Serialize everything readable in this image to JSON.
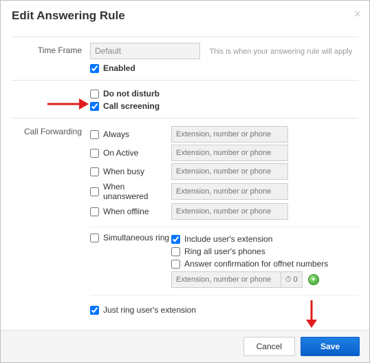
{
  "title": "Edit Answering Rule",
  "timeFrame": {
    "label": "Time Frame",
    "value": "Default",
    "help": "This is when your answering rule will apply",
    "enabledLabel": "Enabled"
  },
  "options": {
    "dndLabel": "Do not disturb",
    "screeningLabel": "Call screening"
  },
  "forwarding": {
    "label": "Call Forwarding",
    "placeholder": "Extension, number or phone",
    "items": [
      {
        "label": "Always"
      },
      {
        "label": "On Active"
      },
      {
        "label": "When busy"
      },
      {
        "label": "When unanswered"
      },
      {
        "label": "When offline"
      }
    ]
  },
  "simring": {
    "label": "Simultaneous ring",
    "includeExtLabel": "Include user's extension",
    "ringAllLabel": "Ring all user's phones",
    "answerConfirmLabel": "Answer confirmation for offnet numbers",
    "inputPlaceholder": "Extension, number or phone",
    "ringCount": "0"
  },
  "justRingLabel": "Just ring user's extension",
  "buttons": {
    "cancel": "Cancel",
    "save": "Save"
  }
}
